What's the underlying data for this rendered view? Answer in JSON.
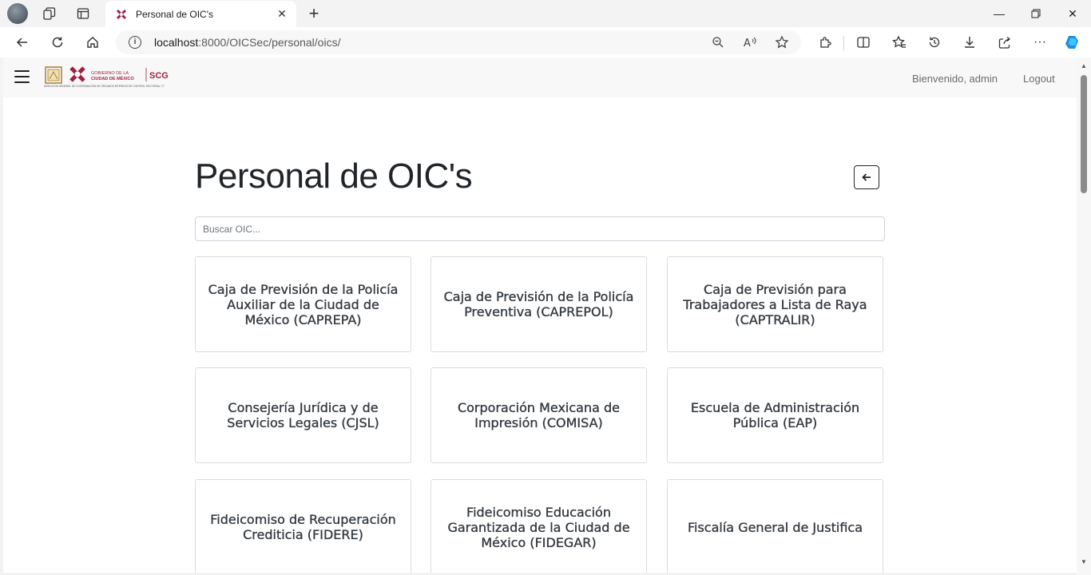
{
  "browser": {
    "tab_title": "Personal de OIC's",
    "url_host": "localhost",
    "url_rest": ":8000/OICSec/personal/oics/"
  },
  "header": {
    "logo_text_1": "GOBIERNO DE LA",
    "logo_text_2": "CIUDAD DE MÉXICO",
    "logo_scg": "SCG",
    "logo_subtitle": "DIRECCIÓN GENERAL DE COORDINACIÓN DE ÓRGANOS INTERNOS DE CONTROL SECTORIAL \"C\"",
    "welcome": "Bienvenido,  admin",
    "logout": "Logout"
  },
  "main": {
    "title": "Personal de OIC's",
    "search_placeholder": "Buscar OIC...",
    "cards": [
      "Caja de Previsión de la Policía Auxiliar de la Ciudad de México (CAPREPA)",
      "Caja de Previsión de la Policía Preventiva (CAPREPOL)",
      "Caja de Previsión para Trabajadores a Lista de Raya (CAPTRALIR)",
      "Consejería Jurídica y de Servicios Legales (CJSL)",
      "Corporación Mexicana de Impresión (COMISA)",
      "Escuela de Administración Pública (EAP)",
      "Fideicomiso de Recuperación Crediticia (FIDERE)",
      "Fideicomiso Educación Garantizada de la Ciudad de México (FIDEGAR)",
      "Fiscalía General de Justifica"
    ]
  },
  "colors": {
    "brand": "#9f2241",
    "header_bg": "#f8f8f8"
  }
}
